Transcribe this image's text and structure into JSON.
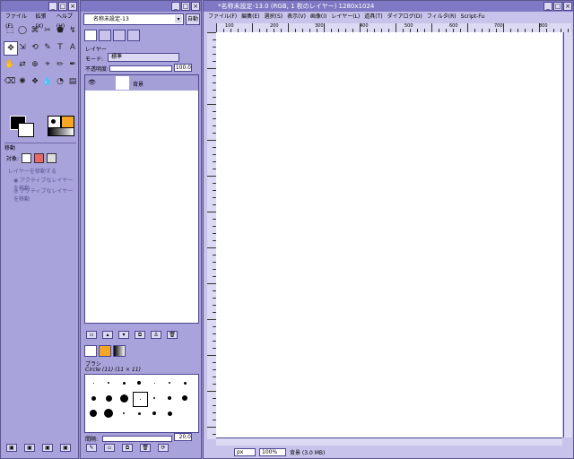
{
  "toolbox": {
    "title": "",
    "menu": [
      "ファイル(F)",
      "拡張(X)",
      "ヘルプ(H)"
    ],
    "tools": [
      "⬚",
      "◯",
      "⌘",
      "✂",
      "⬟",
      "↯",
      "✥",
      "⇲",
      "⟲",
      "✎",
      "T",
      "A",
      "✋",
      "⇄",
      "⊕",
      "⌖",
      "✏",
      "✒",
      "⌫",
      "✺",
      "❖",
      "💧",
      "◔",
      "▤"
    ],
    "move_panel_title": "移動",
    "move_target_label": "対象:",
    "move_option_1": "レイヤーを移動する",
    "move_option_2": "アクティブなレイヤーを移動"
  },
  "layers_window": {
    "title": "",
    "image_select": "名称未設定-13",
    "auto_button": "自動",
    "layers_label": "レイヤー",
    "mode_label": "モード:",
    "mode_value": "標準",
    "opacity_label": "不透明度:",
    "opacity_value": "100.0",
    "layer_name": "背景",
    "brushes_label": "ブラシ",
    "brush_info": "Circle (11) (11 × 11)",
    "spacing_label": "間隔:",
    "spacing_value": "20.0"
  },
  "image_window": {
    "title": "*名称未設定-13.0 (RGB, 1 枚のレイヤー) 1280x1024",
    "menu": [
      "ファイル(F)",
      "編集(E)",
      "選択(S)",
      "表示(V)",
      "画像(I)",
      "レイヤー(L)",
      "道具(T)",
      "ダイアログ(D)",
      "フィルタ(R)",
      "Script-Fu"
    ],
    "ruler_labels": [
      "100",
      "200",
      "300",
      "400",
      "500",
      "600",
      "700",
      "800",
      "900"
    ],
    "unit": "px",
    "zoom": "100%",
    "status": "背景 (3.0 MB)"
  }
}
